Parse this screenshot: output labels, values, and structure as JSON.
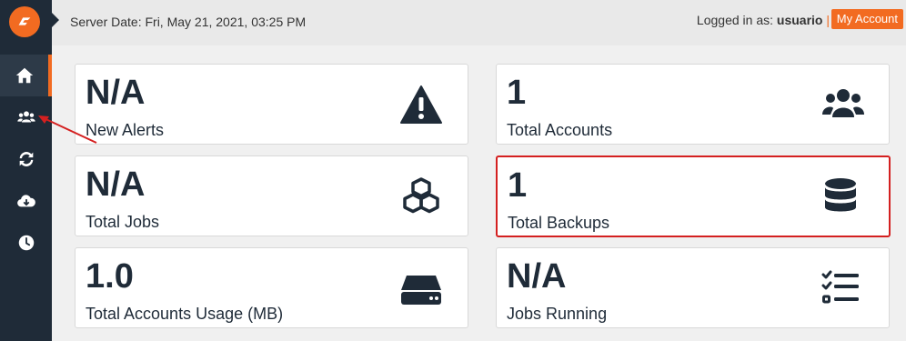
{
  "header": {
    "server_date": "Server Date: Fri, May 21, 2021, 03:25 PM",
    "logged_in_label": "Logged in as:",
    "username": "usuario",
    "separator": "|",
    "my_account": "My Account"
  },
  "sidebar": {
    "items": [
      {
        "icon": "home-icon",
        "active": true
      },
      {
        "icon": "users-icon",
        "active": false
      },
      {
        "icon": "sync-icon",
        "active": false
      },
      {
        "icon": "cloud-download-icon",
        "active": false
      },
      {
        "icon": "clock-icon",
        "active": false
      }
    ]
  },
  "cards": [
    {
      "value": "N/A",
      "label": "New Alerts",
      "icon": "warning-icon"
    },
    {
      "value": "1",
      "label": "Total Accounts",
      "icon": "users-icon"
    },
    {
      "value": "N/A",
      "label": "Total Jobs",
      "icon": "cubes-icon"
    },
    {
      "value": "1",
      "label": "Total Backups",
      "icon": "database-icon"
    },
    {
      "value": "1.0",
      "label": "Total Accounts Usage (MB)",
      "icon": "hdd-icon"
    },
    {
      "value": "N/A",
      "label": "Jobs Running",
      "icon": "tasks-icon"
    }
  ],
  "colors": {
    "accent": "#f26b21",
    "sidebar": "#1f2b38",
    "highlight": "#d42020"
  }
}
